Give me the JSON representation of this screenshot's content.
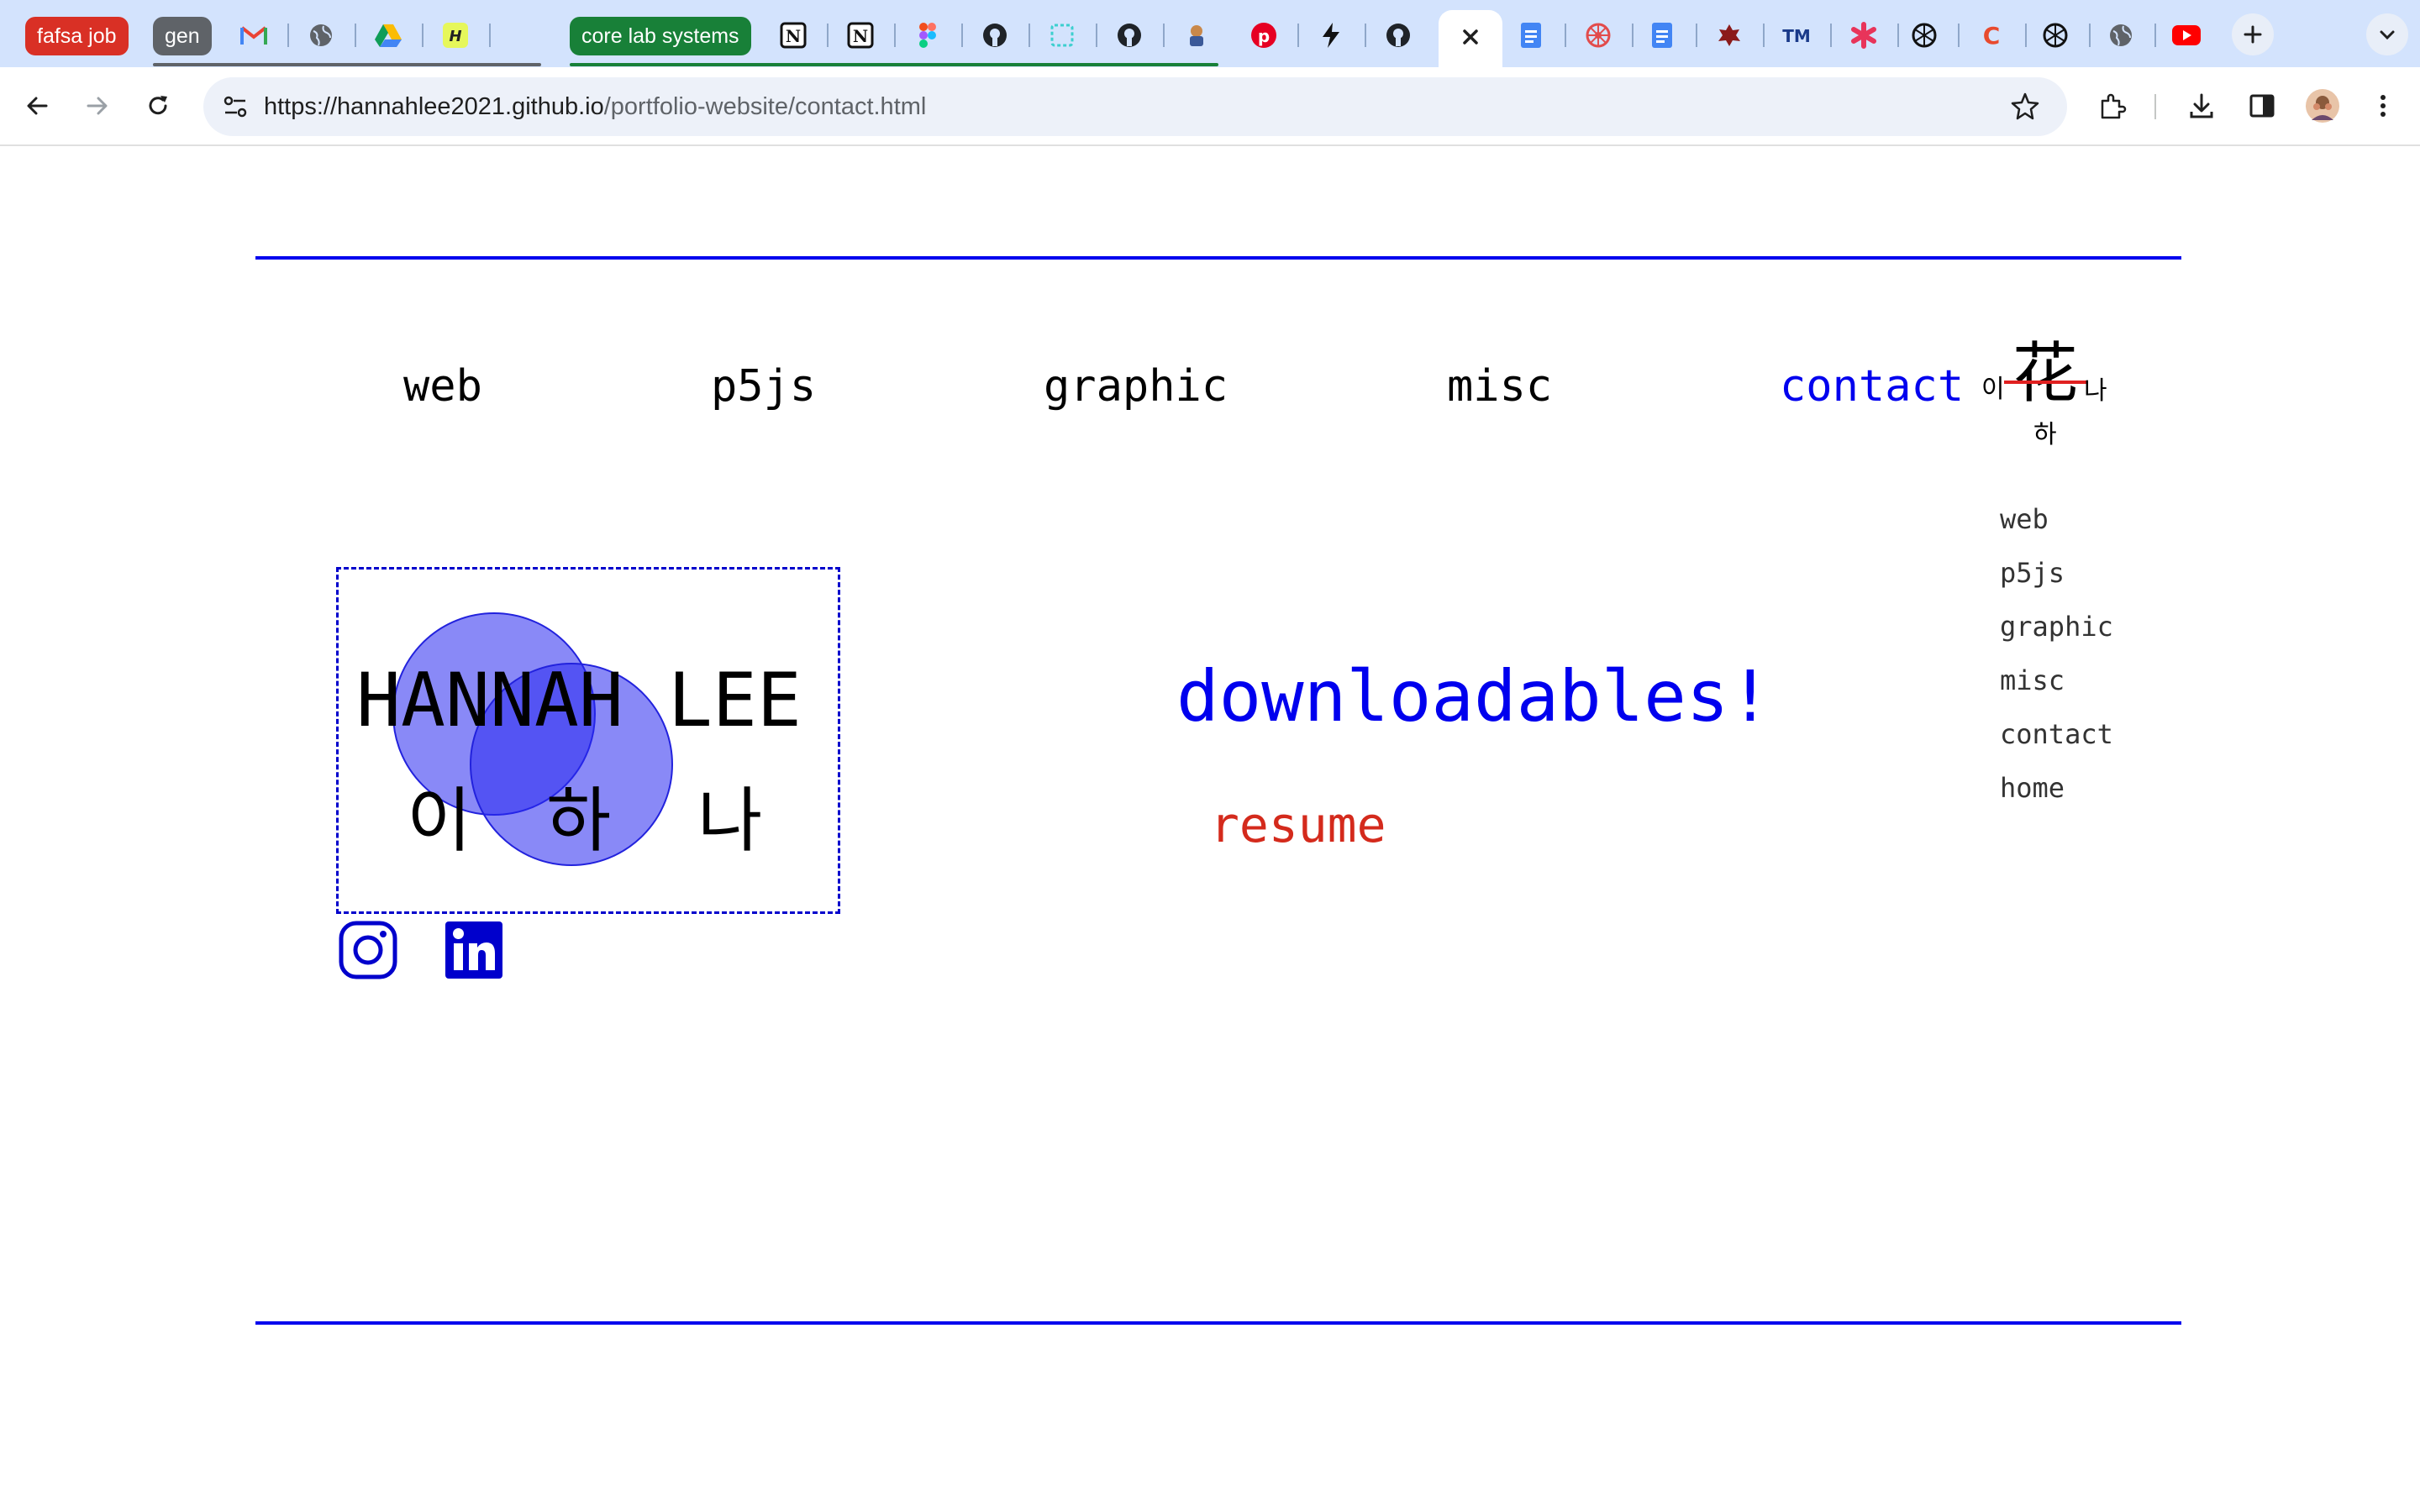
{
  "browser": {
    "tab_groups": [
      {
        "label": "fafsa job",
        "color": "#d93025"
      },
      {
        "label": "gen",
        "color": "#5f6368"
      },
      {
        "label": "core lab systems",
        "color": "#188038"
      }
    ],
    "tab_icons": [
      "gmail-icon",
      "globe-icon",
      "drive-icon",
      "hackmd-icon",
      "blank-icon",
      "notion-icon",
      "notion-icon",
      "figma-icon",
      "github-icon",
      "dashed-square-icon",
      "github-icon",
      "character-icon",
      "pinterest-icon",
      "bolt-icon",
      "github-icon",
      "close-icon",
      "docs-icon",
      "wheel-icon",
      "docs-icon",
      "leaf-icon",
      "tm-icon",
      "asterisk-icon",
      "openai-icon",
      "c-icon",
      "openai-icon",
      "globe-icon",
      "youtube-icon"
    ],
    "url_host": "https://hannahlee2021.github.io",
    "url_path": "/portfolio-website/contact.html",
    "accent": "#0000ee"
  },
  "nav": {
    "web": "web",
    "p5js": "p5js",
    "graphic": "graphic",
    "misc": "misc",
    "contact": "contact"
  },
  "logo": {
    "hanja": "花",
    "left": "이",
    "right": "나",
    "bottom": "하"
  },
  "side_menu": [
    "web",
    "p5js",
    "graphic",
    "misc",
    "contact",
    "home"
  ],
  "card": {
    "name": "HANNAH LEE",
    "hangul": [
      "이",
      "하",
      "나"
    ]
  },
  "downloads": {
    "title": "downloadables!",
    "resume": "resume"
  },
  "social": [
    "instagram-icon",
    "linkedin-icon"
  ]
}
